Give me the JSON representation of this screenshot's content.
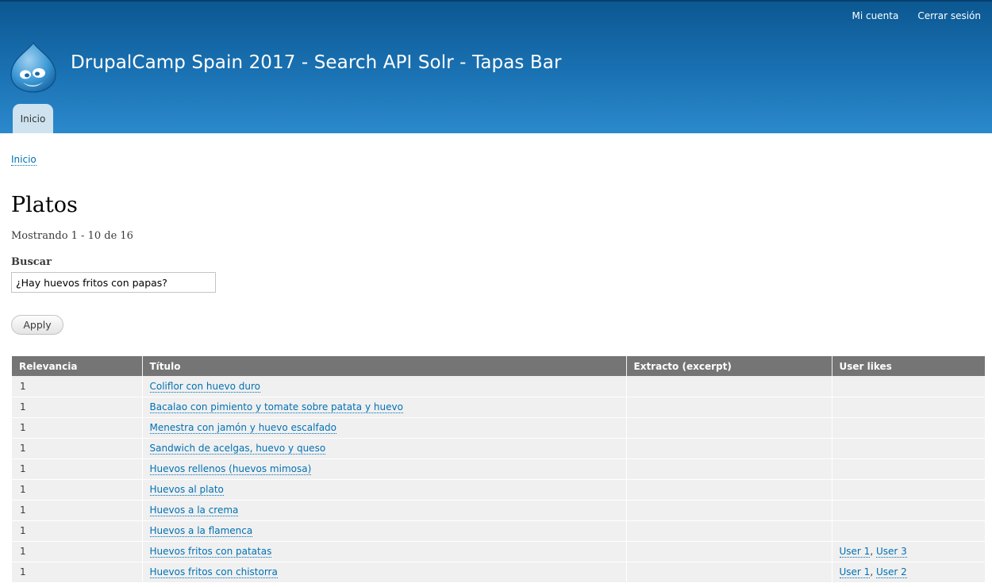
{
  "header": {
    "secondary_menu": [
      "Mi cuenta",
      "Cerrar sesión"
    ],
    "site_name": "DrupalCamp Spain 2017 - Search API Solr - Tapas Bar",
    "logo_icon": "drupal-drop-icon",
    "main_menu": [
      "Inicio"
    ]
  },
  "breadcrumb": [
    "Inicio"
  ],
  "page": {
    "title": "Platos",
    "summary": "Mostrando 1 - 10 de 16"
  },
  "search": {
    "label": "Buscar",
    "value": "¿Hay huevos fritos con papas?",
    "apply_label": "Apply"
  },
  "table": {
    "headers": [
      "Relevancia",
      "Título",
      "Extracto (excerpt)",
      "User likes"
    ],
    "rows": [
      {
        "relevance": "1",
        "title": "Coliflor con huevo duro",
        "excerpt": "",
        "likes": []
      },
      {
        "relevance": "1",
        "title": "Bacalao con pimiento y tomate sobre patata y huevo",
        "excerpt": "",
        "likes": []
      },
      {
        "relevance": "1",
        "title": "Menestra con jamón y huevo escalfado",
        "excerpt": "",
        "likes": []
      },
      {
        "relevance": "1",
        "title": "Sandwich de acelgas, huevo y queso",
        "excerpt": "",
        "likes": []
      },
      {
        "relevance": "1",
        "title": "Huevos rellenos (huevos mimosa)",
        "excerpt": "",
        "likes": []
      },
      {
        "relevance": "1",
        "title": "Huevos al plato",
        "excerpt": "",
        "likes": []
      },
      {
        "relevance": "1",
        "title": "Huevos a la crema",
        "excerpt": "",
        "likes": []
      },
      {
        "relevance": "1",
        "title": "Huevos a la flamenca",
        "excerpt": "",
        "likes": []
      },
      {
        "relevance": "1",
        "title": "Huevos fritos con patatas",
        "excerpt": "",
        "likes": [
          "User 1",
          "User 3"
        ]
      },
      {
        "relevance": "1",
        "title": "Huevos fritos con chistorra",
        "excerpt": "",
        "likes": [
          "User 1",
          "User 2"
        ]
      }
    ]
  },
  "colors": {
    "header_top": "#0b5791",
    "header_bottom": "#2b89cc",
    "link": "#0071b3",
    "table_header_bg": "#757575",
    "row_bg": "#f0f0f0",
    "tab_bg": "#cfe2ef"
  }
}
